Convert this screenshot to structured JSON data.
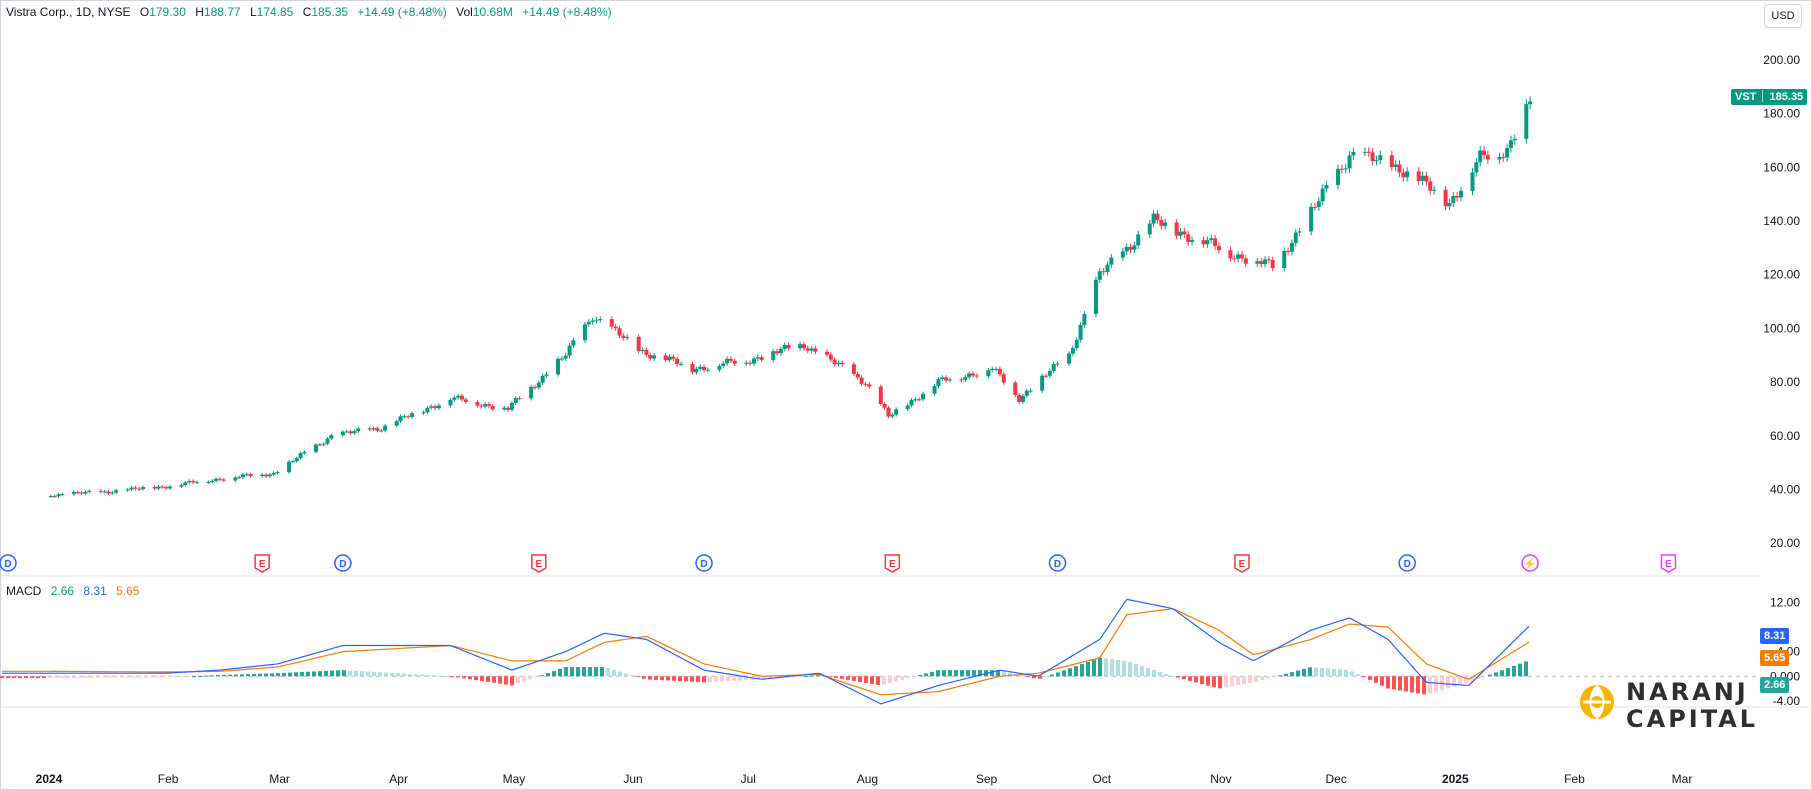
{
  "header": {
    "symbol": "Vistra Corp., 1D, NYSE",
    "o_label": "O",
    "o_value": "179.30",
    "h_label": "H",
    "h_value": "188.77",
    "l_label": "L",
    "l_value": "174.85",
    "c_label": "C",
    "c_value": "185.35",
    "change": "+14.49 (+8.48%)",
    "vol_label": "Vol",
    "vol_value": "10.68M",
    "vol_change": "+14.49 (+8.48%)"
  },
  "currency": "USD",
  "price_tag": {
    "ticker": "VST",
    "value": "185.35"
  },
  "macd_legend": {
    "label": "MACD",
    "hist": "2.66",
    "macd": "8.31",
    "signal": "5.65"
  },
  "macd_tags": {
    "macd": "8.31",
    "signal": "5.65",
    "hist": "2.66"
  },
  "logo": {
    "line1": "NARANJ",
    "line2": "CAPITAL"
  },
  "colors": {
    "up": "#089981",
    "down": "#f23645",
    "macd": "#2962ff",
    "signal": "#f57c00",
    "hist_up_strong": "#26a69a",
    "hist_up_weak": "#b2dfdb",
    "hist_down_strong": "#ff5252",
    "hist_down_weak": "#ffcdd2",
    "event_dividend": "#2962ff",
    "event_earnings": "#f23645",
    "event_future": "#e040fb"
  },
  "chart_data": [
    {
      "type": "candlestick",
      "title": "Vistra Corp., 1D, NYSE",
      "ylim": [
        10,
        210
      ],
      "y_ticks": [
        "20.00",
        "40.00",
        "60.00",
        "80.00",
        "100.00",
        "120.00",
        "140.00",
        "160.00",
        "180.00",
        "200.00"
      ],
      "x_ticks": [
        "2024",
        "Feb",
        "Mar",
        "Apr",
        "May",
        "Jun",
        "Jul",
        "Aug",
        "Sep",
        "Oct",
        "Nov",
        "Dec",
        "2025",
        "Feb",
        "Mar"
      ],
      "x_tick_dates": [
        "2024-01-01",
        "2024-02-01",
        "2024-03-01",
        "2024-04-01",
        "2024-05-01",
        "2024-06-01",
        "2024-07-01",
        "2024-08-01",
        "2024-09-01",
        "2024-10-01",
        "2024-11-01",
        "2024-12-01",
        "2025-01-01",
        "2025-02-01",
        "2025-03-01"
      ],
      "series": [
        {
          "dates": [
            "2024-01-02",
            "2024-01-15",
            "2024-01-31",
            "2024-02-15",
            "2024-02-29",
            "2024-03-15",
            "2024-03-28",
            "2024-04-15",
            "2024-04-30",
            "2024-05-15",
            "2024-05-22",
            "2024-06-03",
            "2024-06-17",
            "2024-07-01",
            "2024-07-16",
            "2024-08-01",
            "2024-08-07",
            "2024-08-20",
            "2024-09-03",
            "2024-09-10",
            "2024-09-23",
            "2024-10-01",
            "2024-10-15",
            "2024-11-04",
            "2024-11-15",
            "2024-11-25",
            "2024-12-05",
            "2024-12-18",
            "2024-12-31",
            "2025-01-08",
            "2025-01-15",
            "2025-01-21"
          ],
          "close": [
            38,
            39,
            41,
            44,
            46,
            60,
            63,
            74,
            70,
            90,
            105,
            92,
            85,
            88,
            94,
            80,
            67,
            80,
            85,
            74,
            90,
            120,
            140,
            128,
            123,
            143,
            165,
            160,
            147,
            163,
            167,
            185.35
          ]
        }
      ],
      "events": [
        {
          "type": "dividend",
          "label": "D",
          "date": "2024-01-02"
        },
        {
          "type": "earnings",
          "label": "E",
          "date": "2024-02-26"
        },
        {
          "type": "dividend",
          "label": "D",
          "date": "2024-03-18"
        },
        {
          "type": "earnings",
          "label": "E",
          "date": "2024-05-08"
        },
        {
          "type": "dividend",
          "label": "D",
          "date": "2024-06-20"
        },
        {
          "type": "earnings",
          "label": "E",
          "date": "2024-08-08"
        },
        {
          "type": "dividend",
          "label": "D",
          "date": "2024-09-20"
        },
        {
          "type": "earnings",
          "label": "E",
          "date": "2024-11-07"
        },
        {
          "type": "dividend",
          "label": "D",
          "date": "2024-12-20"
        },
        {
          "type": "split",
          "label": "⚡",
          "date": "2025-01-21"
        },
        {
          "type": "earnings_future",
          "label": "E",
          "date": "2025-02-26"
        }
      ]
    },
    {
      "type": "line",
      "title": "MACD",
      "ylim": [
        -5,
        15
      ],
      "y_ticks": [
        "-4.00",
        "0.000",
        "4.00",
        "12.00"
      ],
      "x": [
        "2024-01-01",
        "2024-02-01",
        "2024-02-15",
        "2024-03-01",
        "2024-03-18",
        "2024-04-01",
        "2024-04-15",
        "2024-05-01",
        "2024-05-15",
        "2024-05-25",
        "2024-06-05",
        "2024-06-20",
        "2024-07-05",
        "2024-07-20",
        "2024-08-05",
        "2024-08-20",
        "2024-09-05",
        "2024-09-15",
        "2024-10-01",
        "2024-10-08",
        "2024-10-20",
        "2024-11-01",
        "2024-11-10",
        "2024-11-25",
        "2024-12-05",
        "2024-12-15",
        "2024-12-25",
        "2025-01-05",
        "2025-01-21"
      ],
      "series": [
        {
          "name": "MACD",
          "values": [
            0.5,
            0.5,
            1.0,
            2.0,
            5.0,
            5.0,
            5.0,
            1.0,
            4.0,
            7.0,
            6.0,
            1.0,
            -0.5,
            0.5,
            -4.5,
            -1.5,
            1.0,
            0.0,
            6.0,
            12.5,
            11.0,
            5.5,
            2.5,
            7.5,
            9.5,
            6.0,
            -1.0,
            -1.5,
            8.31
          ]
        },
        {
          "name": "Signal",
          "values": [
            0.8,
            0.7,
            0.8,
            1.5,
            4.0,
            4.5,
            5.0,
            2.5,
            2.5,
            5.5,
            6.5,
            2.0,
            0.0,
            0.3,
            -3.0,
            -2.5,
            0.0,
            0.5,
            3.0,
            10.0,
            11.0,
            7.5,
            3.5,
            6.0,
            8.5,
            8.0,
            2.0,
            -0.5,
            5.65
          ]
        },
        {
          "name": "Histogram",
          "values": [
            -0.3,
            -0.2,
            0.2,
            0.5,
            1.0,
            0.5,
            0.0,
            -1.5,
            1.5,
            1.5,
            -0.5,
            -1.0,
            -0.5,
            0.2,
            -1.5,
            1.0,
            1.0,
            -0.5,
            3.0,
            2.5,
            0.0,
            -2.0,
            -1.0,
            1.5,
            1.0,
            -2.0,
            -3.0,
            -1.0,
            2.66
          ]
        }
      ]
    }
  ]
}
